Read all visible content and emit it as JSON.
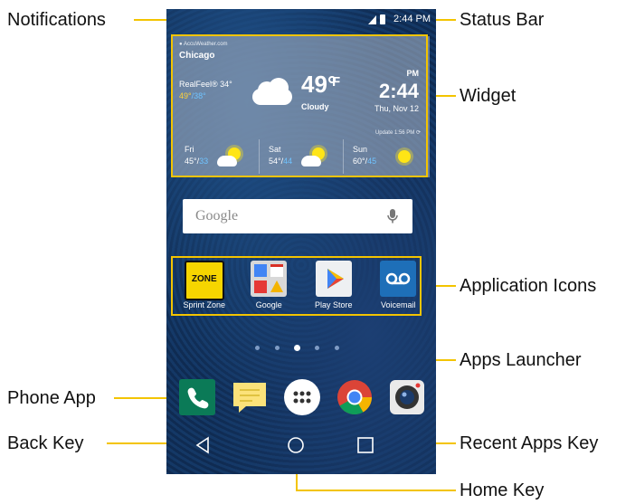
{
  "callouts": {
    "notifications": "Notifications",
    "status_bar": "Status Bar",
    "widget": "Widget",
    "application_icons": "Application Icons",
    "apps_launcher": "Apps Launcher",
    "phone_app": "Phone App",
    "back_key": "Back Key",
    "recent_apps_key": "Recent Apps Key",
    "home_key": "Home Key"
  },
  "status_bar": {
    "time": "2:44 PM",
    "icons": [
      "signal-icon",
      "battery-icon"
    ]
  },
  "weather_widget": {
    "source": "AccuWeather.com",
    "city": "Chicago",
    "realfeel": "RealFeel® 34°",
    "high": "49°",
    "separator": "/",
    "low": "38°",
    "temperature": "49°",
    "unit": "F",
    "condition": "Cloudy",
    "ampm": "PM",
    "time": "2:44",
    "date": "Thu, Nov 12",
    "update": "Update 1:56 PM",
    "forecast": [
      {
        "day": "Fri",
        "high": "45°",
        "low": "33",
        "icon": "partly-sunny-icon"
      },
      {
        "day": "Sat",
        "high": "54°",
        "low": "44",
        "icon": "partly-sunny-icon"
      },
      {
        "day": "Sun",
        "high": "60°",
        "low": "45",
        "icon": "sunny-icon"
      }
    ]
  },
  "search_bar": {
    "label": "Google",
    "icon": "microphone-icon"
  },
  "apps": [
    {
      "label": "Sprint Zone",
      "icon": "sprint-zone-icon",
      "icon_text": "ZONE"
    },
    {
      "label": "Google",
      "icon": "google-folder-icon"
    },
    {
      "label": "Play Store",
      "icon": "play-store-icon"
    },
    {
      "label": "Voicemail",
      "icon": "voicemail-icon"
    }
  ],
  "page_indicator": {
    "pages": 5,
    "current": 3
  },
  "dock": [
    "phone-icon",
    "messaging-icon",
    "apps-launcher-icon",
    "chrome-icon",
    "camera-icon"
  ],
  "nav_keys": [
    "back-key-icon",
    "home-key-icon",
    "recent-apps-key-icon"
  ],
  "colors": {
    "callout_line": "#f3c400",
    "highlight_box": "#f3c400",
    "phone_green": "#0b7a57"
  }
}
